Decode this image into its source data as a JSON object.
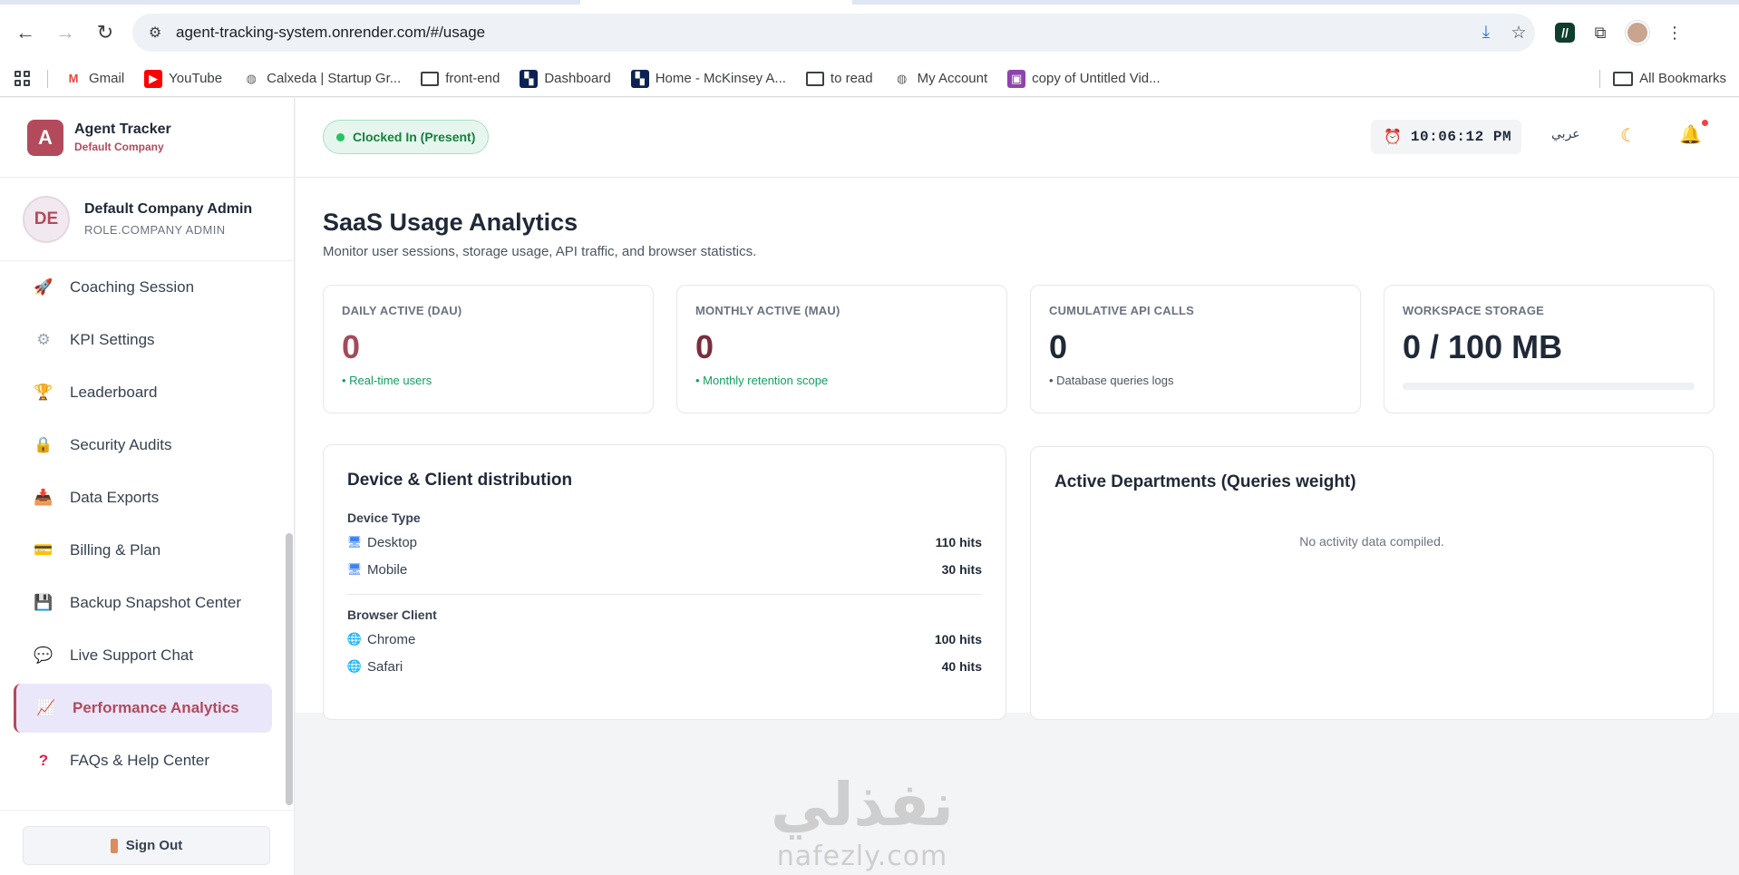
{
  "browser": {
    "url": "agent-tracking-system.onrender.com/#/usage",
    "bookmarks": [
      {
        "label": "Gmail",
        "icon": "gmail-icon"
      },
      {
        "label": "YouTube",
        "icon": "youtube-icon"
      },
      {
        "label": "Calxeda | Startup Gr...",
        "icon": "globe-icon"
      },
      {
        "label": "front-end",
        "icon": "folder-icon"
      },
      {
        "label": "Dashboard",
        "icon": "dashboard-icon"
      },
      {
        "label": "Home - McKinsey A...",
        "icon": "mckinsey-icon"
      },
      {
        "label": "to read",
        "icon": "folder-icon"
      },
      {
        "label": "My Account",
        "icon": "globe-icon"
      },
      {
        "label": "copy of Untitled Vid...",
        "icon": "video-icon"
      }
    ],
    "all_bookmarks": "All Bookmarks"
  },
  "sidebar": {
    "brand_initial": "A",
    "brand_name": "Agent Tracker",
    "brand_company": "Default Company",
    "user_initials": "DE",
    "user_name": "Default Company Admin",
    "user_role": "ROLE.COMPANY ADMIN",
    "items": [
      {
        "label": "Coaching Session",
        "icon": "rocket-icon"
      },
      {
        "label": "KPI Settings",
        "icon": "gear-icon"
      },
      {
        "label": "Leaderboard",
        "icon": "trophy-icon"
      },
      {
        "label": "Security Audits",
        "icon": "lock-icon"
      },
      {
        "label": "Data Exports",
        "icon": "inbox-icon"
      },
      {
        "label": "Billing & Plan",
        "icon": "credit-card-icon"
      },
      {
        "label": "Backup Snapshot Center",
        "icon": "floppy-disk-icon"
      },
      {
        "label": "Live Support Chat",
        "icon": "speech-bubble-icon"
      },
      {
        "label": "Performance Analytics",
        "icon": "chart-icon",
        "active": true
      },
      {
        "label": "FAQs & Help Center",
        "icon": "question-mark-icon"
      }
    ],
    "sign_out": "Sign Out"
  },
  "topbar": {
    "status": "Clocked In (Present)",
    "time": "10:06:12 PM",
    "language": "عربي"
  },
  "page": {
    "title": "SaaS Usage Analytics",
    "subtitle": "Monitor user sessions, storage usage, API traffic, and browser statistics."
  },
  "stats": [
    {
      "label": "DAILY ACTIVE (DAU)",
      "value": "0",
      "note": "• Real-time users"
    },
    {
      "label": "MONTHLY ACTIVE (MAU)",
      "value": "0",
      "note": "• Monthly retention scope"
    },
    {
      "label": "CUMULATIVE API CALLS",
      "value": "0",
      "note": "• Database queries logs"
    },
    {
      "label": "WORKSPACE STORAGE",
      "value": "0 / 100 MB",
      "storage_fraction": 0
    }
  ],
  "devices_panel": {
    "title": "Device & Client distribution",
    "device_group": "Device Type",
    "devices": [
      {
        "label": "Desktop",
        "hits": "110 hits",
        "icon": "desktop-icon"
      },
      {
        "label": "Mobile",
        "hits": "30 hits",
        "icon": "desktop-icon"
      }
    ],
    "browser_group": "Browser Client",
    "browsers": [
      {
        "label": "Chrome",
        "hits": "100 hits",
        "icon": "globe-icon"
      },
      {
        "label": "Safari",
        "hits": "40 hits",
        "icon": "globe-icon"
      }
    ]
  },
  "departments_panel": {
    "title": "Active Departments (Queries weight)",
    "empty": "No activity data compiled."
  },
  "watermark": {
    "arabic": "نفذلي",
    "latin": "nafezly.com"
  }
}
